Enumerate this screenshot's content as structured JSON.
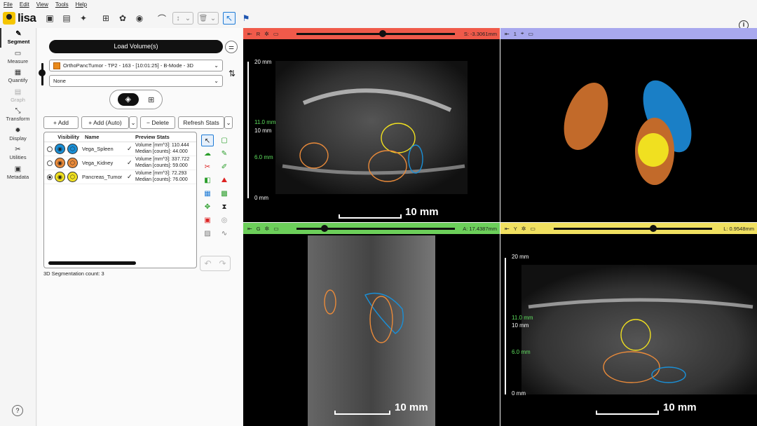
{
  "menu": [
    "File",
    "Edit",
    "View",
    "Tools",
    "Help"
  ],
  "app": {
    "name": "lisa"
  },
  "nav": [
    {
      "label": "Segment",
      "icon": "✎",
      "state": "active"
    },
    {
      "label": "Measure",
      "icon": "▭",
      "state": "normal"
    },
    {
      "label": "Quantify",
      "icon": "▦",
      "state": "normal"
    },
    {
      "label": "Graph",
      "icon": "▤",
      "state": "disabled"
    },
    {
      "label": "Transform",
      "icon": "⤡",
      "state": "normal"
    },
    {
      "label": "Display",
      "icon": "✹",
      "state": "normal"
    },
    {
      "label": "Utilities",
      "icon": "✂",
      "state": "normal"
    },
    {
      "label": "Metadata",
      "icon": "▣",
      "state": "normal"
    }
  ],
  "panel": {
    "load_volume": "Load Volume(s)",
    "volume_select": "OrthoPancTumor - TP2 - 163 - [10:01:25] - B-Mode - 3D",
    "overlay_select": "None",
    "add": "+ Add",
    "add_auto": "+ Add (Auto)",
    "delete": "− Delete",
    "refresh": "Refresh Stats",
    "headers": {
      "visibility": "Visibility",
      "name": "Name",
      "stats": "Preview Stats"
    },
    "segmentations": [
      {
        "name": "Vega_Spleen",
        "color": "#1a8fd6",
        "selected": false,
        "volume": "Volume [mm^3]: 110.444",
        "median": "Median [counts]: 44.000"
      },
      {
        "name": "Vega_Kidney",
        "color": "#e98a3a",
        "selected": false,
        "volume": "Volume [mm^3]: 337.722",
        "median": "Median [counts]: 59.000"
      },
      {
        "name": "Pancreas_Tumor",
        "color": "#f0e020",
        "selected": true,
        "volume": "Volume [mm^3]: 72.293",
        "median": "Median [counts]: 76.000"
      }
    ],
    "seg_count": "3D Segmentation count: 3"
  },
  "views": {
    "sagittal": {
      "label": "R",
      "pos": "S: -3.3061mm",
      "color": "#f05a4a",
      "slider": 0.6
    },
    "render3d": {
      "label": "1",
      "color": "#a8a8ee"
    },
    "coronal": {
      "label": "G",
      "pos": "A: 17.4387mm",
      "color": "#6ccf5a",
      "slider": 0.15
    },
    "axial": {
      "label": "Y",
      "pos": "L: 0.9548mm",
      "color": "#f0e060",
      "slider": 0.6
    }
  },
  "scale": {
    "bar_label": "10 mm",
    "ticks": [
      "20 mm",
      "11.0 mm",
      "10 mm",
      "6.0 mm",
      "0 mm"
    ]
  }
}
